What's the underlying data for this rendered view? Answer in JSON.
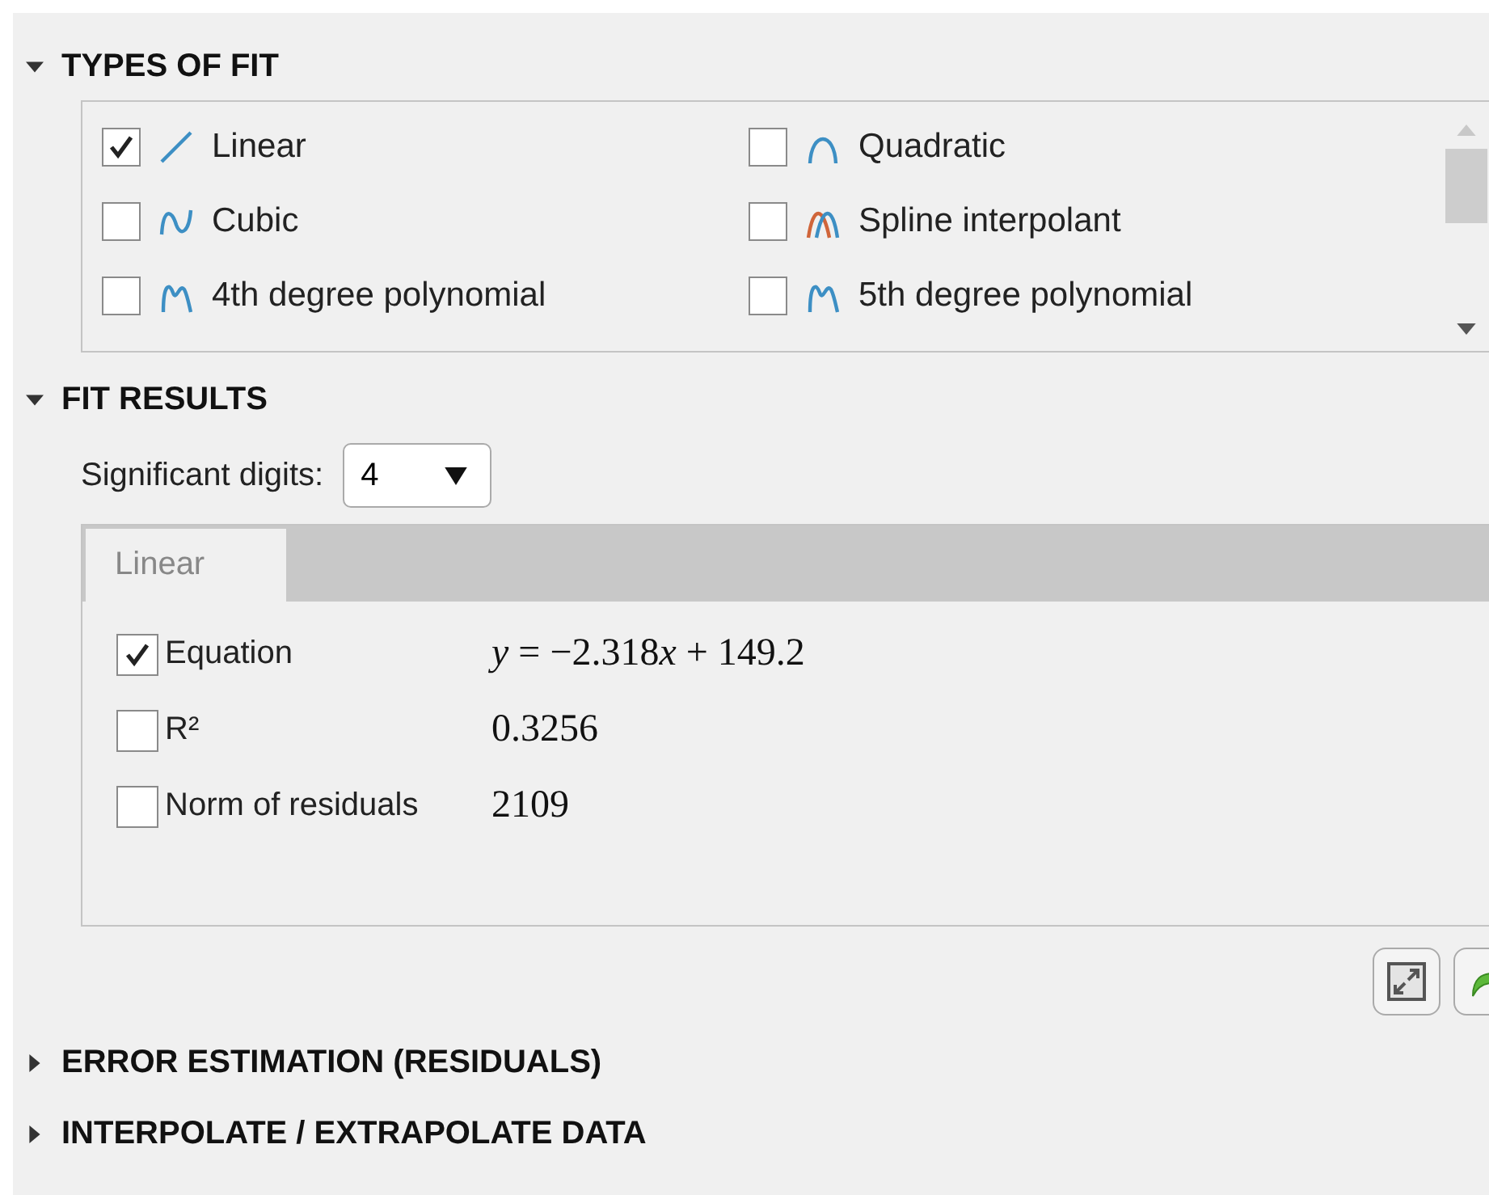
{
  "sections": [
    {
      "title": "TYPES OF FIT",
      "expanded": true
    },
    {
      "title": "FIT RESULTS",
      "expanded": true
    },
    {
      "title": "ERROR ESTIMATION (RESIDUALS)",
      "expanded": false
    },
    {
      "title": "INTERPOLATE / EXTRAPOLATE DATA",
      "expanded": false
    }
  ],
  "fit_types": [
    {
      "label": "Linear",
      "kind": "linear",
      "checked": true
    },
    {
      "label": "Quadratic",
      "kind": "quadratic",
      "checked": false
    },
    {
      "label": "Cubic",
      "kind": "cubic",
      "checked": false
    },
    {
      "label": "Spline interpolant",
      "kind": "spline",
      "checked": false
    },
    {
      "label": "4th degree polynomial",
      "kind": "poly",
      "checked": false
    },
    {
      "label": "5th degree polynomial",
      "kind": "poly",
      "checked": false
    }
  ],
  "significant_digits": {
    "label": "Significant digits:",
    "value": "4"
  },
  "result_tabs": [
    {
      "label": "Linear",
      "selected": true
    }
  ],
  "results": [
    {
      "label": "Equation",
      "checked": true,
      "value": [
        {
          "text": "y",
          "italic": true
        },
        {
          "text": " = −2.318",
          "italic": false
        },
        {
          "text": "x",
          "italic": true
        },
        {
          "text": " + 149.2",
          "italic": false
        }
      ]
    },
    {
      "label": "R²",
      "checked": false,
      "value": [
        {
          "text": "0.3256",
          "italic": false
        }
      ]
    },
    {
      "label": "Norm of residuals",
      "checked": false,
      "value": [
        {
          "text": "2109",
          "italic": false
        }
      ]
    }
  ]
}
